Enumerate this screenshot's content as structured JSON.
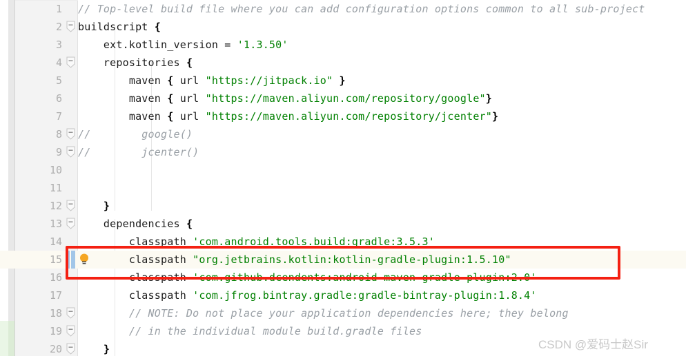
{
  "editor": {
    "language": "groovy",
    "file_kind": "gradle-build-file",
    "current_line": 15,
    "gutter_sep_color": "#e2e2e2",
    "current_line_bg": "#fcfaf2",
    "string_color": "#008000",
    "comment_color": "#9aa0a6",
    "annotation_rect_color": "#f42012",
    "change_marker_color": "#a2c6e8",
    "vcs_added_color": "#eaf6e6"
  },
  "icons": {
    "fold_collapse": "fold-minus-icon",
    "lightbulb": "lightbulb-icon"
  },
  "lines": [
    {
      "n": 1,
      "fold": false,
      "tokens": [
        {
          "t": "// Top-level build file where you can add configuration options common to all sub-project",
          "c": "cmt"
        }
      ]
    },
    {
      "n": 2,
      "fold": true,
      "tokens": [
        {
          "t": "buildscript ",
          "c": "plain"
        },
        {
          "t": "{",
          "c": "punct"
        }
      ]
    },
    {
      "n": 3,
      "fold": false,
      "tokens": [
        {
          "t": "    ext.kotlin_version = ",
          "c": "plain"
        },
        {
          "t": "'1.3.50'",
          "c": "str"
        }
      ]
    },
    {
      "n": 4,
      "fold": true,
      "tokens": [
        {
          "t": "    repositories ",
          "c": "plain"
        },
        {
          "t": "{",
          "c": "punct"
        }
      ]
    },
    {
      "n": 5,
      "fold": false,
      "tokens": [
        {
          "t": "        maven ",
          "c": "plain"
        },
        {
          "t": "{",
          "c": "punct"
        },
        {
          "t": " url ",
          "c": "plain"
        },
        {
          "t": "\"https://jitpack.io\"",
          "c": "str"
        },
        {
          "t": " }",
          "c": "punct"
        }
      ]
    },
    {
      "n": 6,
      "fold": false,
      "tokens": [
        {
          "t": "        maven ",
          "c": "plain"
        },
        {
          "t": "{",
          "c": "punct"
        },
        {
          "t": " url ",
          "c": "plain"
        },
        {
          "t": "\"https://maven.aliyun.com/repository/google\"",
          "c": "str"
        },
        {
          "t": "}",
          "c": "punct"
        }
      ]
    },
    {
      "n": 7,
      "fold": false,
      "tokens": [
        {
          "t": "        maven ",
          "c": "plain"
        },
        {
          "t": "{",
          "c": "punct"
        },
        {
          "t": " url ",
          "c": "plain"
        },
        {
          "t": "\"https://maven.aliyun.com/repository/jcenter\"",
          "c": "str"
        },
        {
          "t": "}",
          "c": "punct"
        }
      ]
    },
    {
      "n": 8,
      "fold": true,
      "tokens": [
        {
          "t": "//        google()",
          "c": "cmt"
        }
      ]
    },
    {
      "n": 9,
      "fold": true,
      "tokens": [
        {
          "t": "//        jcenter()",
          "c": "cmt"
        }
      ]
    },
    {
      "n": 10,
      "fold": false,
      "tokens": []
    },
    {
      "n": 11,
      "fold": false,
      "tokens": []
    },
    {
      "n": 12,
      "fold": true,
      "tokens": [
        {
          "t": "    }",
          "c": "punct"
        }
      ]
    },
    {
      "n": 13,
      "fold": true,
      "tokens": [
        {
          "t": "    dependencies ",
          "c": "plain"
        },
        {
          "t": "{",
          "c": "punct"
        }
      ]
    },
    {
      "n": 14,
      "fold": false,
      "tokens": [
        {
          "t": "        classpath ",
          "c": "plain"
        },
        {
          "t": "'com.android.tools.build:gradle:3.5.3'",
          "c": "str"
        }
      ]
    },
    {
      "n": 15,
      "fold": false,
      "current": true,
      "bulb": true,
      "changed": true,
      "tokens": [
        {
          "t": "        classpath ",
          "c": "plain"
        },
        {
          "t": "\"org.jetbrains.kotlin:kotlin-gradle-plugin:1.5.10\"",
          "c": "str"
        }
      ]
    },
    {
      "n": 16,
      "fold": false,
      "tokens": [
        {
          "t": "        classpath ",
          "c": "plain"
        },
        {
          "t": "'com.github.dcendents:android-maven-gradle-plugin:2.0'",
          "c": "str"
        }
      ]
    },
    {
      "n": 17,
      "fold": false,
      "tokens": [
        {
          "t": "        classpath ",
          "c": "plain"
        },
        {
          "t": "'com.jfrog.bintray.gradle:gradle-bintray-plugin:1.8.4'",
          "c": "str"
        }
      ]
    },
    {
      "n": 18,
      "fold": true,
      "tokens": [
        {
          "t": "        // NOTE: Do not place your application dependencies here; they belong",
          "c": "cmt"
        }
      ]
    },
    {
      "n": 19,
      "fold": true,
      "tokens": [
        {
          "t": "        // in the individual module build.gradle files",
          "c": "cmt"
        }
      ]
    },
    {
      "n": 20,
      "fold": true,
      "tokens": [
        {
          "t": "    }",
          "c": "punct"
        }
      ]
    }
  ],
  "watermark": {
    "text": "CSDN @爱码士赵Sir"
  }
}
